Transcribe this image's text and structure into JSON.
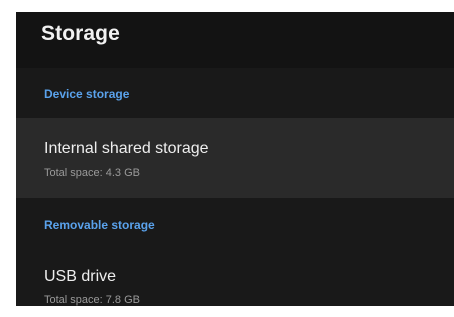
{
  "colors": {
    "accent": "#5aa2ec",
    "background": "#191919",
    "header_background": "#131313",
    "focused_item": "#2a2a2a"
  },
  "header": {
    "title": "Storage"
  },
  "sections": [
    {
      "label": "Device storage",
      "items": [
        {
          "title": "Internal shared storage",
          "subtitle": "Total space: 4.3 GB",
          "focused": true
        }
      ]
    },
    {
      "label": "Removable storage",
      "items": [
        {
          "title": "USB drive",
          "subtitle": "Total space: 7.8 GB",
          "focused": false
        }
      ]
    }
  ]
}
